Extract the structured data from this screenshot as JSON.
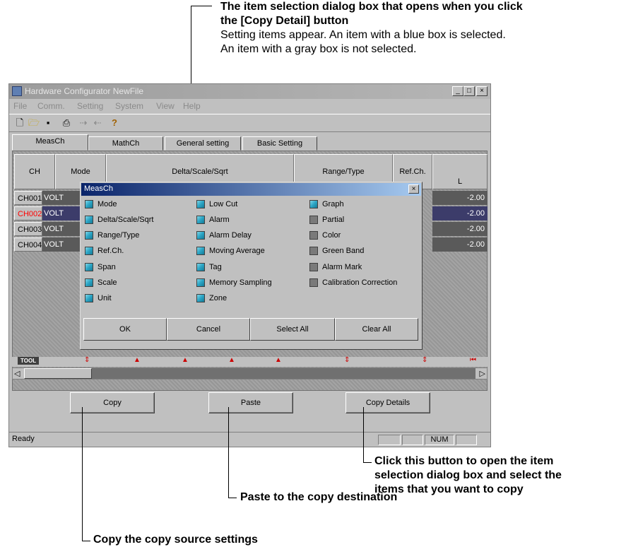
{
  "callouts": {
    "dialog_title_1": "The item selection dialog box that opens when you click",
    "dialog_title_2": "the [Copy Detail] button",
    "dialog_desc_1": "Setting items appear. An item with a blue box is selected.",
    "dialog_desc_2": "An item with a gray box is not selected.",
    "copy_details_1": "Click this button to open the item",
    "copy_details_2": "selection dialog box and select the",
    "copy_details_3": "items that you want to copy",
    "paste": "Paste to the copy destination",
    "copy": "Copy the copy source settings"
  },
  "window": {
    "title": "Hardware Configurator NewFile",
    "menu": [
      "File",
      "Comm.",
      "Setting",
      "System",
      "View",
      "Help"
    ],
    "tabs": [
      "MeasCh",
      "MathCh",
      "General setting",
      "Basic Setting"
    ],
    "columns": [
      "CH",
      "Mode",
      "Delta/Scale/Sqrt",
      "Range/Type",
      "Ref.Ch.",
      "L"
    ],
    "rows": [
      {
        "ch": "CH001",
        "mode": "VOLT",
        "value": "-2.00"
      },
      {
        "ch": "CH002",
        "mode": "VOLT",
        "value": "-2.00"
      },
      {
        "ch": "CH003",
        "mode": "VOLT",
        "value": "-2.00"
      },
      {
        "ch": "CH004",
        "mode": "VOLT",
        "value": "-2.00"
      }
    ],
    "tool_label": "TOOL",
    "buttons": {
      "copy": "Copy",
      "paste": "Paste",
      "copy_details": "Copy Details"
    },
    "status": {
      "text": "Ready",
      "num": "NUM"
    }
  },
  "dialog": {
    "title": "MeasCh",
    "col1": [
      {
        "label": "Mode",
        "checked": true
      },
      {
        "label": "Delta/Scale/Sqrt",
        "checked": true
      },
      {
        "label": "Range/Type",
        "checked": true
      },
      {
        "label": "Ref.Ch.",
        "checked": true
      },
      {
        "label": "Span",
        "checked": true
      },
      {
        "label": "Scale",
        "checked": true
      },
      {
        "label": "Unit",
        "checked": true
      }
    ],
    "col2": [
      {
        "label": "Low Cut",
        "checked": true
      },
      {
        "label": "Alarm",
        "checked": true
      },
      {
        "label": "Alarm Delay",
        "checked": true
      },
      {
        "label": "Moving Average",
        "checked": true
      },
      {
        "label": "Tag",
        "checked": true
      },
      {
        "label": "Memory Sampling",
        "checked": true
      },
      {
        "label": "Zone",
        "checked": true
      }
    ],
    "col3": [
      {
        "label": "Graph",
        "checked": true
      },
      {
        "label": "Partial",
        "checked": false
      },
      {
        "label": "Color",
        "checked": false
      },
      {
        "label": "Green Band",
        "checked": false
      },
      {
        "label": "Alarm Mark",
        "checked": false
      },
      {
        "label": "Calibration Correction",
        "checked": false
      }
    ],
    "buttons": {
      "ok": "OK",
      "cancel": "Cancel",
      "select_all": "Select All",
      "clear_all": "Clear All"
    }
  },
  "colors": {
    "selected_box": "#2aa4c4",
    "unselected_box": "#7a7a7a",
    "ch002_text": "#ff0000"
  }
}
